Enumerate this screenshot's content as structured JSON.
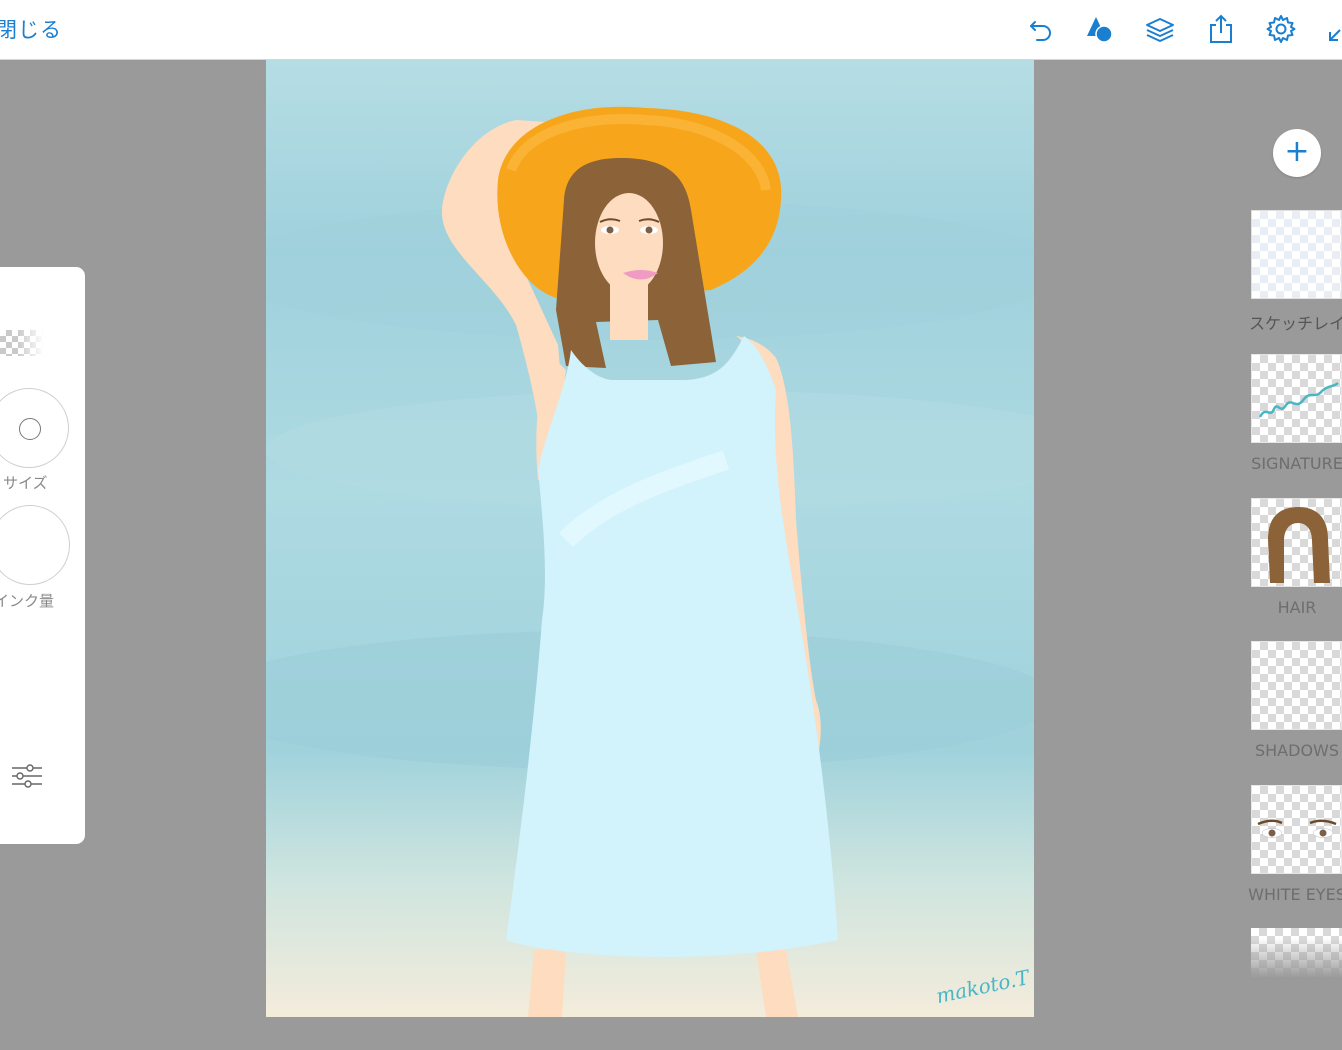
{
  "toolbar": {
    "close_label": "閉じる",
    "icons": [
      "undo-icon",
      "shapes-icon",
      "layers-icon",
      "share-icon",
      "gear-icon",
      "collapse-icon"
    ],
    "accent": "#1b7fd1"
  },
  "brush_panel": {
    "size_label": "サイズ",
    "ink_label": "インク量"
  },
  "canvas": {
    "signature_text": "makoto.T",
    "colors": {
      "sky": "#a9d7df",
      "hat": "#f7a61c",
      "hair": "#8c6239",
      "skin": "#fddcbf",
      "dress": "#d2f2fc",
      "lips": "#f09ac4"
    }
  },
  "layers": {
    "add_label": "+",
    "items": [
      {
        "label": "スケッチレイ",
        "thumb": "empty"
      },
      {
        "label": "SIGNATURE",
        "thumb": "signature"
      },
      {
        "label": "HAIR",
        "thumb": "hair"
      },
      {
        "label": "SHADOWS",
        "thumb": "empty"
      },
      {
        "label": "WHITE EYES",
        "thumb": "eyes"
      }
    ]
  }
}
